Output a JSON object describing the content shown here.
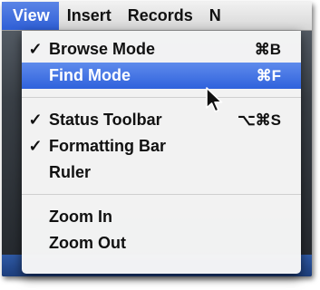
{
  "menubar": {
    "menus": [
      {
        "label": "View",
        "active": true
      },
      {
        "label": "Insert"
      },
      {
        "label": "Records"
      },
      {
        "label": "N"
      }
    ]
  },
  "dropdown": {
    "items": [
      {
        "label": "Browse Mode",
        "checked": true,
        "check_mark": "✓",
        "shortcut": "⌘B"
      },
      {
        "label": "Find Mode",
        "highlighted": true,
        "shortcut": "⌘F"
      },
      {
        "label": "Status Toolbar",
        "checked": true,
        "check_mark": "✓",
        "shortcut": "⌥⌘S"
      },
      {
        "label": "Formatting Bar",
        "checked": true,
        "check_mark": "✓"
      },
      {
        "label": "Ruler"
      },
      {
        "label": "Zoom In"
      },
      {
        "label": "Zoom Out"
      }
    ]
  },
  "colors": {
    "highlight": "#3366dd",
    "menu_bg": "#f6f6f6",
    "text": "#111111"
  }
}
